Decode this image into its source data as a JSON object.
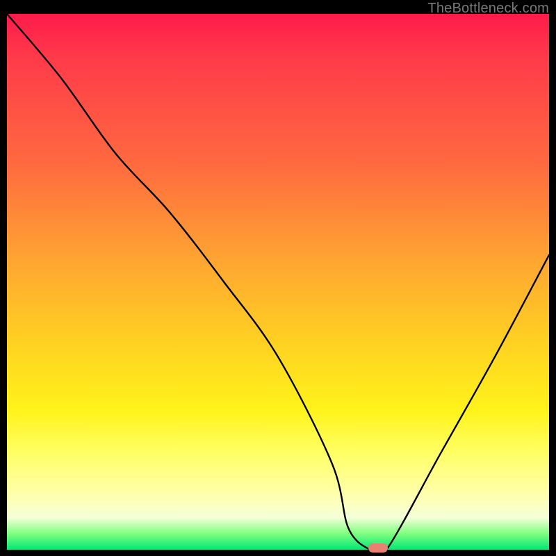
{
  "watermark": "TheBottleneck.com",
  "chart_data": {
    "type": "line",
    "title": "",
    "xlabel": "",
    "ylabel": "",
    "xlim": [
      0,
      100
    ],
    "ylim": [
      0,
      100
    ],
    "grid": false,
    "legend": false,
    "series": [
      {
        "name": "curve",
        "x": [
          0,
          10,
          20,
          30,
          40,
          50,
          60,
          63,
          67,
          70,
          80,
          90,
          100
        ],
        "values": [
          100,
          88,
          74,
          63,
          50,
          36,
          16,
          4,
          0,
          0,
          18,
          36,
          55
        ]
      }
    ],
    "marker": {
      "x": 68.5,
      "y": 0,
      "color": "#e98074"
    },
    "gradient_stops": [
      {
        "pct": 0,
        "color": "#ff1a4a"
      },
      {
        "pct": 28,
        "color": "#ff6a3f"
      },
      {
        "pct": 62,
        "color": "#ffd321"
      },
      {
        "pct": 82,
        "color": "#ffff66"
      },
      {
        "pct": 97,
        "color": "#7fff7f"
      },
      {
        "pct": 100,
        "color": "#00e676"
      }
    ]
  }
}
